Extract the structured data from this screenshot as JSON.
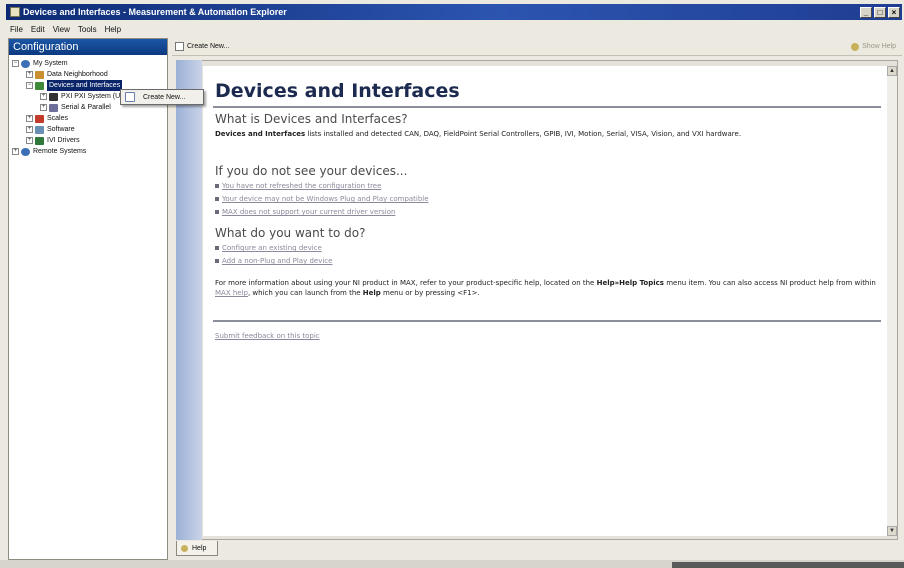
{
  "window": {
    "title": "Devices and Interfaces - Measurement & Automation Explorer",
    "controls": [
      "_",
      "□",
      "×"
    ]
  },
  "menu": [
    "File",
    "Edit",
    "View",
    "Tools",
    "Help"
  ],
  "config": {
    "header": "Configuration",
    "tree": [
      {
        "label": "My System",
        "icon": "computer-icon",
        "expander": "−"
      },
      {
        "label": "Data Neighborhood",
        "icon": "data-neighborhood-icon",
        "expander": "+"
      },
      {
        "label": "Devices and Interfaces",
        "icon": "devices-icon",
        "expander": "−",
        "selected": true
      },
      {
        "label": "PXI PXI System (Un",
        "icon": "pxi-icon",
        "expander": "+"
      },
      {
        "label": "Serial & Parallel",
        "icon": "serial-icon",
        "expander": "+"
      },
      {
        "label": "Scales",
        "icon": "scales-icon",
        "expander": "+"
      },
      {
        "label": "Software",
        "icon": "software-icon",
        "expander": "+"
      },
      {
        "label": "IVI Drivers",
        "icon": "ivi-icon",
        "expander": "+"
      },
      {
        "label": "Remote Systems",
        "icon": "remote-icon",
        "expander": "+"
      }
    ]
  },
  "context_menu": {
    "item": "Create New..."
  },
  "toolbar": {
    "create_new": "Create New...",
    "show_help": "Show Help"
  },
  "help": {
    "title": "Devices and Interfaces",
    "what_is_heading": "What is Devices and Interfaces?",
    "what_is_bold": "Devices and Interfaces",
    "what_is_text": " lists installed and detected CAN, DAQ, FieldPoint Serial Controllers, GPIB, IVI, Motion, Serial, VISA, Vision, and VXI hardware.",
    "not_see_heading": "If you do not see your devices...",
    "not_see_links": [
      "You have not refreshed the configuration tree",
      "Your device may not be Windows Plug and Play compatible",
      "MAX does not support your current driver version"
    ],
    "want_heading": "What do you want to do?",
    "want_links": [
      "Configure an existing device",
      "Add a non-Plug and Play device"
    ],
    "more_1": "For more information about using your NI product in MAX, refer to your product-specific help, located on the ",
    "more_bold_1": "Help»Help Topics",
    "more_2": " menu item. You can also access NI product help from within ",
    "more_link": "MAX help",
    "more_3": ", which you can launch from the ",
    "more_bold_2": "Help",
    "more_4": " menu or by pressing <F1>.",
    "feedback": "Submit feedback on this topic"
  },
  "bottom_tab": {
    "label": "Help"
  }
}
